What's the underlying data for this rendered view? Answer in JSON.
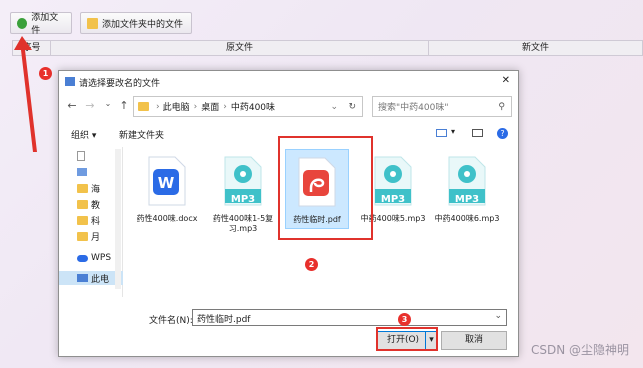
{
  "app": {
    "add_file_label": "添加文件",
    "add_folder_label": "添加文件夹中的文件",
    "columns": [
      "序号",
      "原文件",
      "新文件"
    ]
  },
  "dialog": {
    "title": "请选择要改名的文件",
    "close_glyph": "✕",
    "breadcrumb": [
      "此电脑",
      "桌面",
      "中药400味"
    ],
    "search_placeholder": "搜索\"中药400味\"",
    "organize_label": "组织 ▾",
    "new_folder_label": "新建文件夹",
    "nav_items": [
      "海",
      "教",
      "科",
      "月",
      "WPS",
      "此电"
    ],
    "files": [
      {
        "name": "药性400味.docx",
        "type": "wps"
      },
      {
        "name": "药性400味1-5复习.mp3",
        "type": "mp3"
      },
      {
        "name": "药性临时.pdf",
        "type": "pdf",
        "selected": true
      },
      {
        "name": "中药400味5.mp3",
        "type": "mp3"
      },
      {
        "name": "中药400味6.mp3",
        "type": "mp3"
      }
    ],
    "mp3_label": "MP3",
    "filename_label": "文件名(N):",
    "filename_value": "药性临时.pdf",
    "open_label": "打开(O)",
    "cancel_label": "取消"
  },
  "annotations": {
    "step1": "1",
    "step2": "2",
    "step3": "3"
  },
  "watermark": "CSDN @尘隐神明",
  "colors": {
    "accent": "#e0322c",
    "wps_blue": "#2b6be6",
    "pdf_red": "#e8453c",
    "mp3_teal": "#3fc1c9"
  }
}
